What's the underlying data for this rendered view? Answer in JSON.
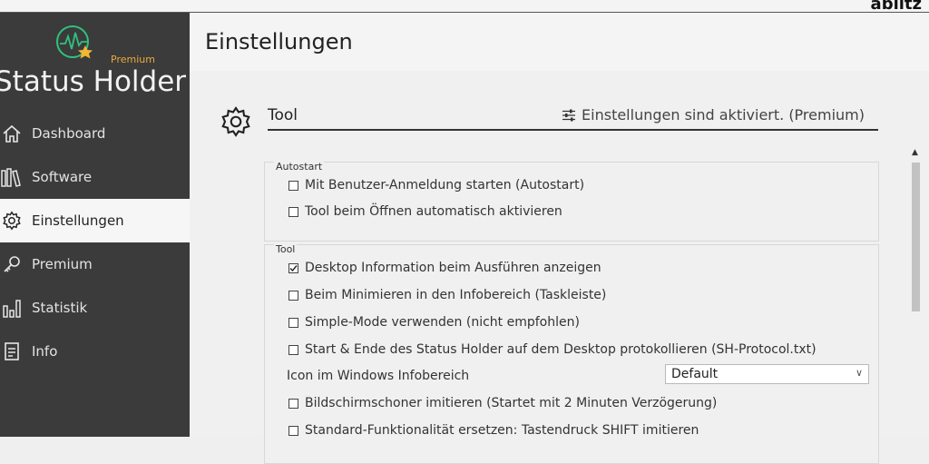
{
  "brand": "ablitz",
  "app": {
    "name": "Status Holder",
    "premium_tag": "Premium"
  },
  "sidebar": {
    "items": [
      {
        "label": "Dashboard",
        "icon": "home-icon"
      },
      {
        "label": "Software",
        "icon": "books-icon"
      },
      {
        "label": "Einstellungen",
        "icon": "gear-icon",
        "active": true
      },
      {
        "label": "Premium",
        "icon": "key-icon"
      },
      {
        "label": "Statistik",
        "icon": "bar-chart-icon"
      },
      {
        "label": "Info",
        "icon": "document-icon"
      }
    ]
  },
  "header": {
    "title": "Einstellungen"
  },
  "section": {
    "title": "Tool",
    "status": "Einstellungen sind aktiviert. (Premium)"
  },
  "groups": {
    "autostart": {
      "legend": "Autostart",
      "options": [
        {
          "label": "Mit Benutzer-Anmeldung starten (Autostart)",
          "checked": false
        },
        {
          "label": "Tool beim Öffnen automatisch aktivieren",
          "checked": false
        }
      ]
    },
    "tool": {
      "legend": "Tool",
      "options": [
        {
          "label": "Desktop Information beim Ausführen anzeigen",
          "checked": true
        },
        {
          "label": "Beim Minimieren in den Infobereich (Taskleiste)",
          "checked": false
        },
        {
          "label": "Simple-Mode verwenden (nicht empfohlen)",
          "checked": false
        },
        {
          "label": "Start & Ende des Status Holder auf dem Desktop protokollieren (SH-Protocol.txt)",
          "checked": false
        }
      ],
      "icon_setting": {
        "label": "Icon im Windows Infobereich",
        "value": "Default"
      },
      "options_more": [
        {
          "label": "Bildschirmschoner imitieren (Startet mit 2 Minuten Verzögerung)",
          "checked": false
        },
        {
          "label": "Standard-Funktionalität ersetzen: Tastendruck SHIFT imitieren",
          "checked": false
        }
      ]
    }
  },
  "colors": {
    "sidebar_bg": "#3b3b3b",
    "active_bg": "#f6f6f6",
    "logo_green": "#2ec27e",
    "premium_orange": "#e8a93a"
  }
}
